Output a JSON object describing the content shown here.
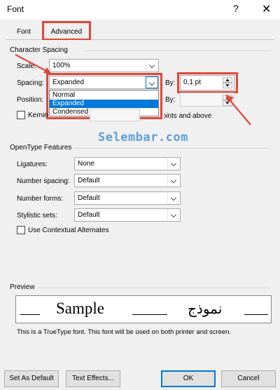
{
  "window": {
    "title": "Font",
    "help": "?",
    "close": "✕"
  },
  "tabs": [
    {
      "label": "Font"
    },
    {
      "label": "Advanced"
    }
  ],
  "character_spacing": {
    "title": "Character Spacing",
    "scale_label": "Scale:",
    "scale_value": "100%",
    "spacing_label": "Spacing:",
    "spacing_value": "Expanded",
    "spacing_options": [
      "Normal",
      "Expanded",
      "Condensed"
    ],
    "by_label": "By:",
    "by_value": "0,1 pt",
    "position_label": "Position:",
    "position_by_label": "By:",
    "kerning_label": "Kerning for fonts:",
    "kerning_suffix": "Points and above"
  },
  "watermark": "Selembar.com",
  "opentype": {
    "title": "OpenType Features",
    "ligatures_label": "Ligatures:",
    "ligatures_value": "None",
    "number_spacing_label": "Number spacing:",
    "number_spacing_value": "Default",
    "number_forms_label": "Number forms:",
    "number_forms_value": "Default",
    "stylistic_sets_label": "Stylistic sets:",
    "stylistic_sets_value": "Default",
    "contextual_label": "Use Contextual Alternates"
  },
  "preview": {
    "title": "Preview",
    "sample_latin": "Sample",
    "sample_arabic": "نموذج",
    "note": "This is a TrueType font. This font will be used on both printer and screen."
  },
  "buttons": {
    "set_default": "Set As Default",
    "text_effects": "Text Effects...",
    "ok": "OK",
    "cancel": "Cancel"
  },
  "colors": {
    "highlight": "#e0473c",
    "selection": "#0078d7",
    "watermark": "#5e9fd8"
  }
}
